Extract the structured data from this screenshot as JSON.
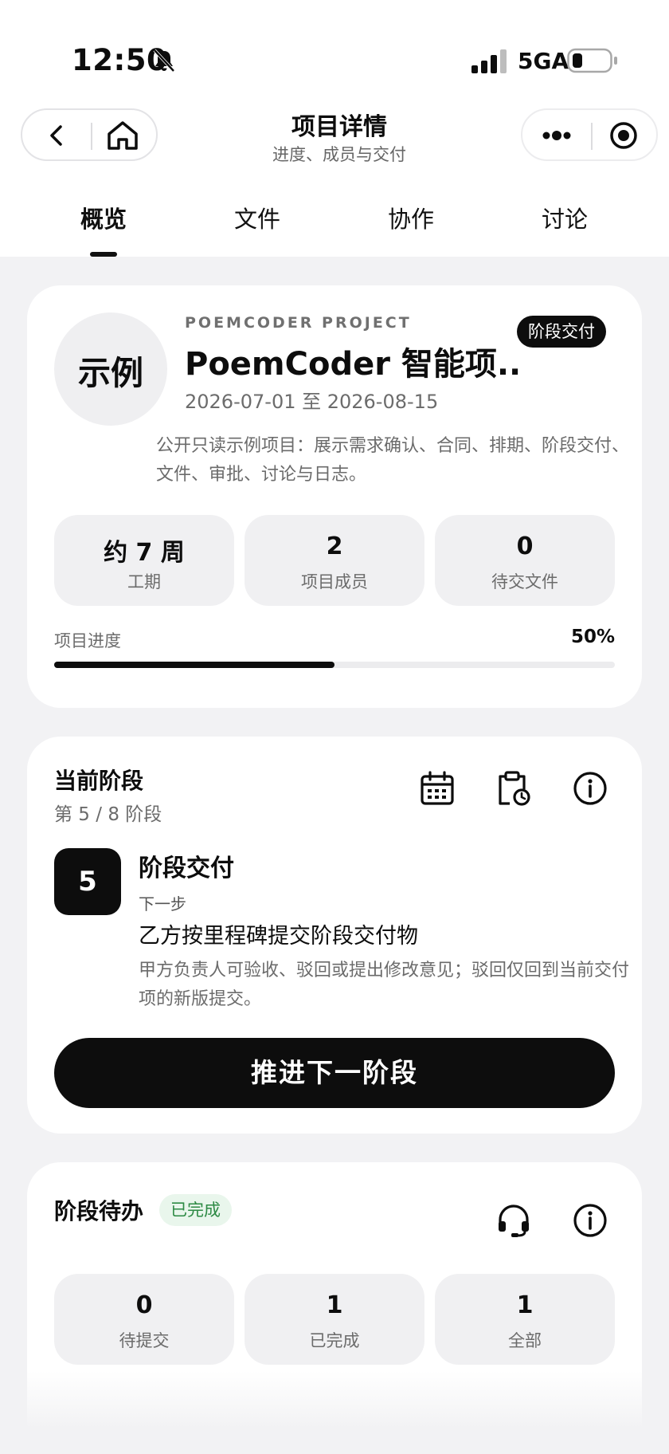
{
  "status_bar": {
    "time": "12:50",
    "network": "5GA",
    "icons": [
      "bell-off-icon",
      "signal-icon",
      "battery-icon"
    ]
  },
  "nav": {
    "title": "项目详情",
    "subtitle": "进度、成员与交付",
    "icons": [
      "back-icon",
      "home-icon",
      "more-icon",
      "target-icon"
    ]
  },
  "tabs": [
    {
      "label": "概览",
      "active": true
    },
    {
      "label": "文件",
      "active": false
    },
    {
      "label": "协作",
      "active": false
    },
    {
      "label": "讨论",
      "active": false
    }
  ],
  "project": {
    "avatar_text": "示例",
    "eyebrow": "POEMCODER PROJECT",
    "title": "PoemCoder 智能项...",
    "dates": "2026-07-01 至 2026-08-15",
    "phase_badge": "阶段交付",
    "description": "公开只读示例项目：展示需求确认、合同、排期、阶段交付、文件、审批、讨论与日志。",
    "stats": [
      {
        "value": "约 7 周",
        "label": "工期"
      },
      {
        "value": "2",
        "label": "项目成员"
      },
      {
        "value": "0",
        "label": "待交文件"
      }
    ],
    "progress_label": "项目进度",
    "progress_value": "50%",
    "progress_fraction": 0.5
  },
  "current_stage": {
    "title": "当前阶段",
    "subtitle": "第 5 / 8 阶段",
    "icons": [
      "calendar-icon",
      "clipboard-clock-icon",
      "info-icon"
    ],
    "step_number": "5",
    "step_title": "阶段交付",
    "next_label": "下一步",
    "next_action": "乙方按里程碑提交阶段交付物",
    "description": "甲方负责人可验收、驳回或提出修改意见；驳回仅回到当前交付项的新版提交。",
    "button": "推进下一阶段"
  },
  "stage_todo": {
    "title": "阶段待办",
    "badge": "已完成",
    "icons": [
      "headset-icon",
      "info-icon"
    ],
    "stats": [
      {
        "value": "0",
        "label": "待提交"
      },
      {
        "value": "1",
        "label": "已完成"
      },
      {
        "value": "1",
        "label": "全部"
      }
    ]
  },
  "colors": {
    "accent": "#0d0d0d",
    "background": "#f2f2f4",
    "success": "#2d8a44"
  }
}
